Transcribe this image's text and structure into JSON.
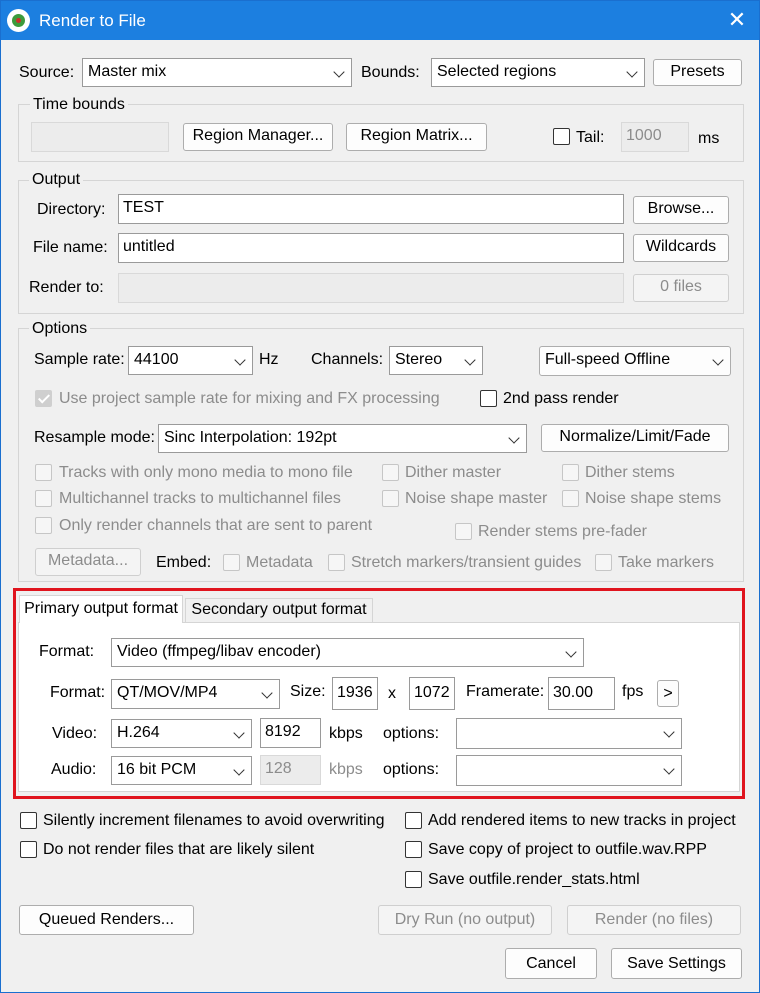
{
  "window": {
    "title": "Render to File",
    "close_icon": "close-icon"
  },
  "source": {
    "label": "Source:",
    "value": "Master mix"
  },
  "bounds": {
    "label": "Bounds:",
    "value": "Selected regions"
  },
  "presets_label": "Presets",
  "time_bounds": {
    "title": "Time bounds",
    "region_manager": "Region Manager...",
    "region_matrix": "Region Matrix...",
    "tail_label": "Tail:",
    "tail_value": "1000",
    "tail_unit": "ms"
  },
  "output": {
    "title": "Output",
    "directory_label": "Directory:",
    "directory_value": "TEST",
    "browse": "Browse...",
    "filename_label": "File name:",
    "filename_value": "untitled",
    "wildcards": "Wildcards",
    "render_to_label": "Render to:",
    "files_count": "0 files"
  },
  "options": {
    "title": "Options",
    "sample_rate_label": "Sample rate:",
    "sample_rate_value": "44100",
    "hz": "Hz",
    "channels_label": "Channels:",
    "channels_value": "Stereo",
    "render_speed": "Full-speed Offline",
    "use_project_rate": "Use project sample rate for mixing and FX processing",
    "second_pass": "2nd pass render",
    "resample_label": "Resample mode:",
    "resample_value": "Sinc Interpolation: 192pt",
    "normalize": "Normalize/Limit/Fade",
    "mono_to_mono": "Tracks with only mono media to mono file",
    "multichannel": "Multichannel tracks to multichannel files",
    "only_parent": "Only render channels that are sent to parent",
    "dither_master": "Dither master",
    "noise_master": "Noise shape master",
    "dither_stems": "Dither stems",
    "noise_stems": "Noise shape stems",
    "stems_prefader": "Render stems pre-fader",
    "metadata_button": "Metadata...",
    "embed_label": "Embed:",
    "embed_metadata": "Metadata",
    "embed_stretch": "Stretch markers/transient guides",
    "embed_take": "Take markers"
  },
  "format_tabs": {
    "primary": "Primary output format",
    "secondary": "Secondary output format",
    "format_label": "Format:",
    "format_value": "Video (ffmpeg/libav encoder)",
    "container_label": "Format:",
    "container_value": "QT/MOV/MP4",
    "size_label": "Size:",
    "width": "1936",
    "x": "x",
    "height": "1072",
    "framerate_label": "Framerate:",
    "framerate_value": "30.00",
    "fps": "fps",
    "more_button": ">",
    "video_label": "Video:",
    "video_codec": "H.264",
    "video_kbps": "8192",
    "kbps": "kbps",
    "options_label": "options:",
    "video_options": "",
    "audio_label": "Audio:",
    "audio_codec": "16 bit PCM",
    "audio_kbps": "128",
    "audio_options": ""
  },
  "bottom": {
    "silently_increment": "Silently increment filenames to avoid overwriting",
    "no_silent": "Do not render files that are likely silent",
    "add_to_tracks": "Add rendered items to new tracks in project",
    "save_copy": "Save copy of project to outfile.wav.RPP",
    "save_stats": "Save outfile.render_stats.html",
    "queued": "Queued Renders...",
    "dry_run": "Dry Run (no output)",
    "render": "Render (no files)",
    "cancel": "Cancel",
    "save_settings": "Save Settings"
  }
}
